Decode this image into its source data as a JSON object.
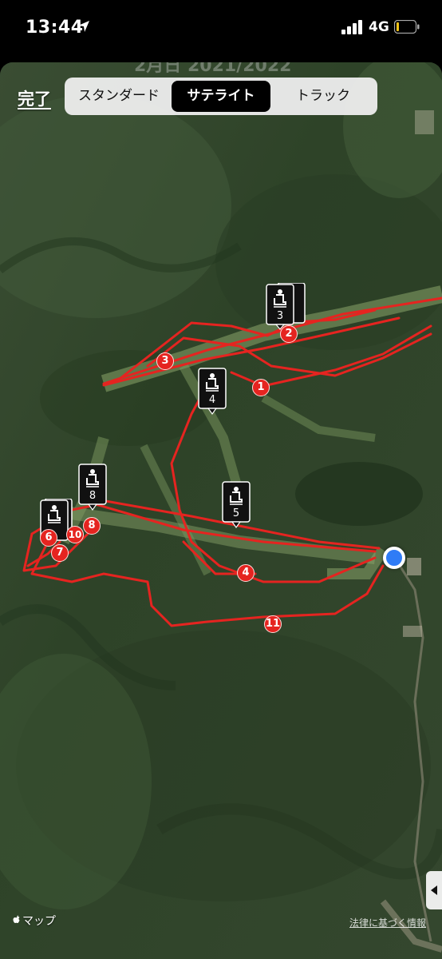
{
  "status_bar": {
    "time": "13:44",
    "network": "4G"
  },
  "map_header_ghost": "2月日 2021/2022",
  "toolbar": {
    "done_label": "完了",
    "segments": [
      "スタンダード",
      "サテライト",
      "トラック"
    ],
    "selected_segment": "サテライト"
  },
  "lift_markers": [
    {
      "label": "3"
    },
    {
      "label": "4"
    },
    {
      "label": "8"
    },
    {
      "label": "5"
    },
    {
      "label": ""
    }
  ],
  "stop_markers": [
    "2",
    "3",
    "1",
    "4",
    "11",
    "6",
    "7",
    "10",
    "8"
  ],
  "attribution": {
    "maps_label": "マップ",
    "legal_label": "法律に基づく情報"
  },
  "colors": {
    "track": "#e52420",
    "location": "#2f7cf6",
    "lift_pin": "#111111"
  }
}
